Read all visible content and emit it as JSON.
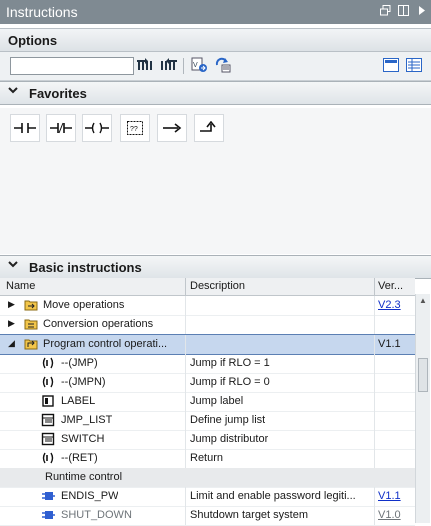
{
  "window": {
    "title": "Instructions"
  },
  "options": {
    "title": "Options",
    "search_value": "",
    "toolbar_icons": [
      "search-next-icon",
      "search-prev-icon",
      "version-icon",
      "refresh-icon",
      "layout-icon",
      "list-view-icon"
    ]
  },
  "favorites": {
    "title": "Favorites",
    "items": [
      "normally-open-contact-icon",
      "normally-closed-contact-icon",
      "coil-icon",
      "empty-box-icon",
      "open-branch-icon",
      "close-branch-icon"
    ]
  },
  "basic": {
    "title": "Basic instructions",
    "columns": {
      "name": "Name",
      "description": "Description",
      "version": "Ver..."
    },
    "rows": [
      {
        "name": "Move operations",
        "description": "",
        "version": "V2.3",
        "version_link": true
      },
      {
        "name": "Conversion operations",
        "description": "",
        "version": ""
      },
      {
        "name": "Program control operati...",
        "description": "",
        "version": "V1.1"
      },
      {
        "name": "--(JMP)",
        "description": "Jump if RLO = 1",
        "version": ""
      },
      {
        "name": "--(JMPN)",
        "description": "Jump if RLO = 0",
        "version": ""
      },
      {
        "name": "LABEL",
        "description": "Jump label",
        "version": ""
      },
      {
        "name": "JMP_LIST",
        "description": "Define jump list",
        "version": ""
      },
      {
        "name": "SWITCH",
        "description": "Jump distributor",
        "version": ""
      },
      {
        "name": "--(RET)",
        "description": "Return",
        "version": ""
      },
      {
        "name": "Runtime control",
        "description": "",
        "version": ""
      },
      {
        "name": "ENDIS_PW",
        "description": "Limit and enable password legiti...",
        "version": "V1.1",
        "version_link": true
      },
      {
        "name": "SHUT_DOWN",
        "description": "Shutdown target system",
        "version": "V1.0",
        "version_link": true
      }
    ]
  },
  "colors": {
    "titlebar": "#7f8a92",
    "selection": "#c6d7ee",
    "link": "#1030c8"
  }
}
